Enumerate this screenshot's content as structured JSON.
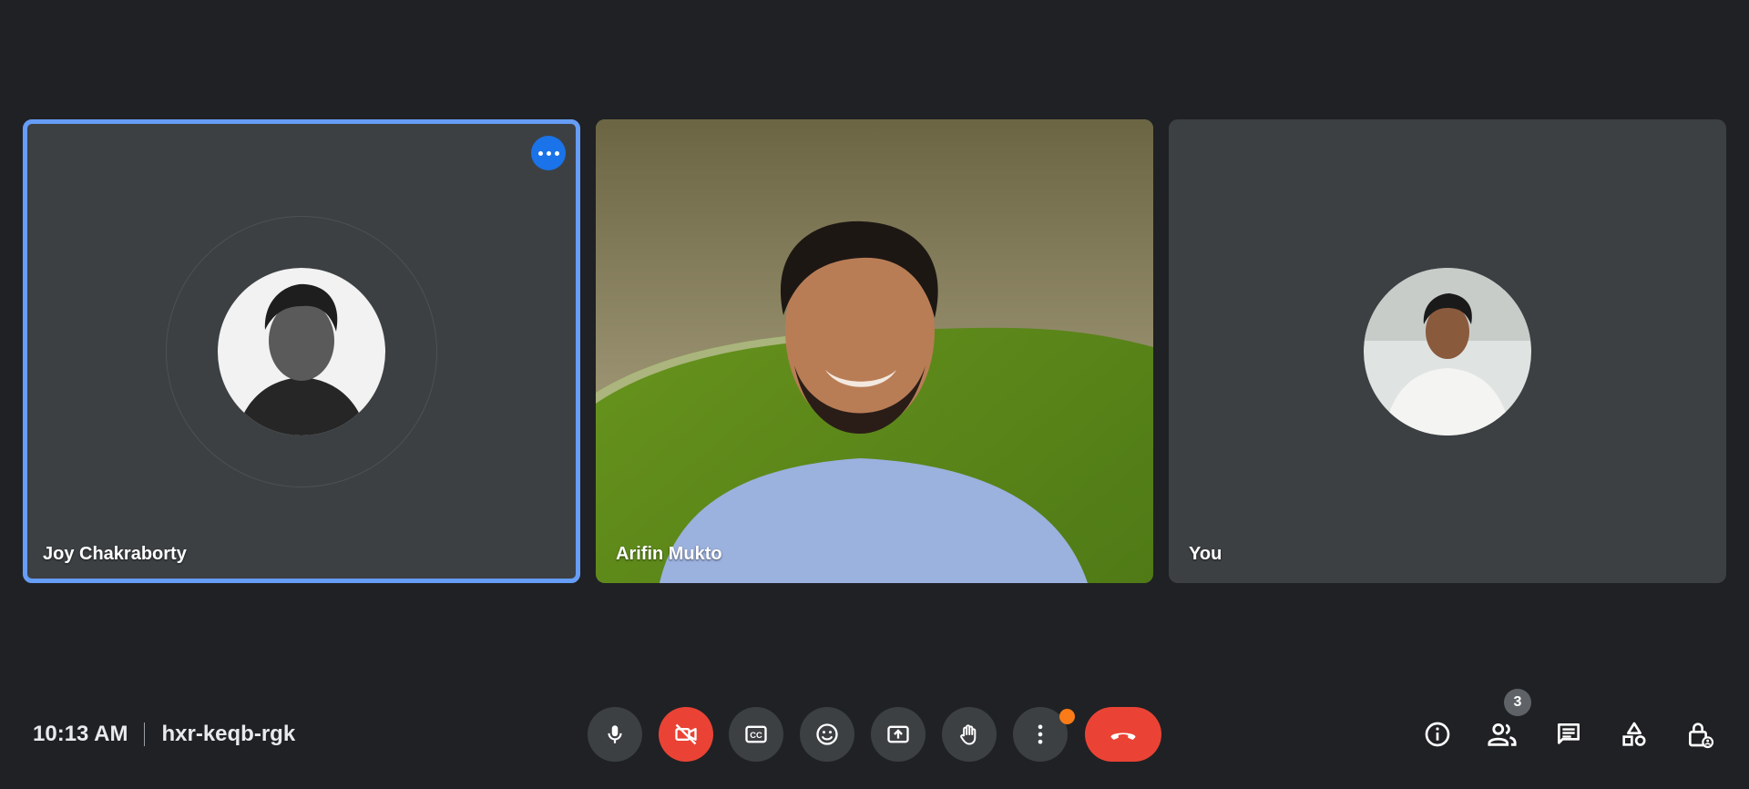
{
  "participants": [
    {
      "name": "Joy Chakraborty",
      "active_speaker": true,
      "camera": "off"
    },
    {
      "name": "Arifin Mukto",
      "camera": "on"
    },
    {
      "name": "You",
      "camera": "off"
    }
  ],
  "meeting": {
    "time": "10:13 AM",
    "code": "hxr-keqb-rgk"
  },
  "controls": [
    {
      "name": "mic",
      "icon": "mic-icon"
    },
    {
      "name": "camera-off",
      "icon": "videocam-off-icon",
      "color": "#ea4335"
    },
    {
      "name": "captions",
      "icon": "closed-caption-icon"
    },
    {
      "name": "emoji",
      "icon": "emoji-icon"
    },
    {
      "name": "present",
      "icon": "present-screen-icon"
    },
    {
      "name": "raise-hand",
      "icon": "hand-icon"
    },
    {
      "name": "more-options",
      "icon": "more-vert-icon",
      "notification_color": "#fa7b17"
    },
    {
      "name": "leave-call",
      "icon": "call-end-icon",
      "color": "#ea4335"
    }
  ],
  "right_tools": {
    "people_count": "3",
    "items": [
      "info-icon",
      "people-icon",
      "chat-icon",
      "activities-icon",
      "host-controls-icon"
    ]
  },
  "colors": {
    "background": "#202124",
    "tile": "#3c4043",
    "active_outline": "#669df6",
    "accent_blue": "#1a73e8",
    "danger": "#ea4335"
  }
}
